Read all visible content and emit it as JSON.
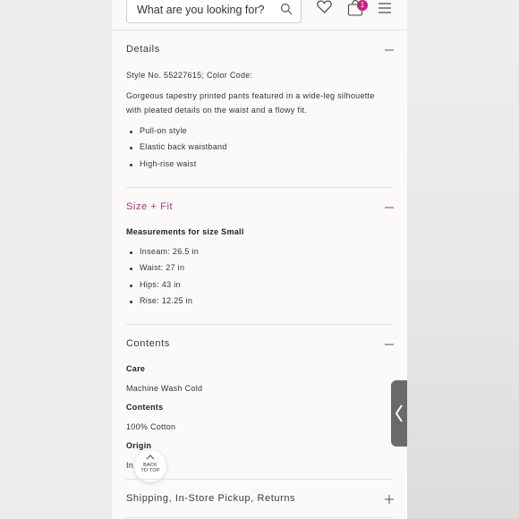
{
  "header": {
    "search_placeholder": "What are you looking for?",
    "bag_count": "1"
  },
  "details": {
    "title": "Details",
    "style_line": "Style No. 55227615; Color Code:",
    "description_line1": "Gorgeous tapestry printed pants featured in a wide-leg silhouette",
    "description_line2": "with pleated details on the waist and a flowy fit.",
    "bullets": [
      "Pull-on style",
      "Elastic back waistband",
      "High-rise waist"
    ]
  },
  "size_fit": {
    "title": "Size + Fit",
    "measurements_heading": "Measurements for size Small",
    "bullets": [
      "Inseam: 26.5 in",
      "Waist: 27 in",
      "Hips: 43 in",
      "Rise: 12.25 in"
    ]
  },
  "contents": {
    "title": "Contents",
    "care_label": "Care",
    "care_value": "Machine Wash Cold",
    "contents_label": "Contents",
    "contents_value": "100% Cotton",
    "origin_label": "Origin",
    "origin_value": "In"
  },
  "back_to_top": {
    "line1": "BACK",
    "line2": "TO TOP"
  },
  "shipping": {
    "title": "Shipping, In-Store Pickup, Returns"
  },
  "colors": {
    "accent_pink": "#b0307a",
    "badge": "#c3227d"
  }
}
